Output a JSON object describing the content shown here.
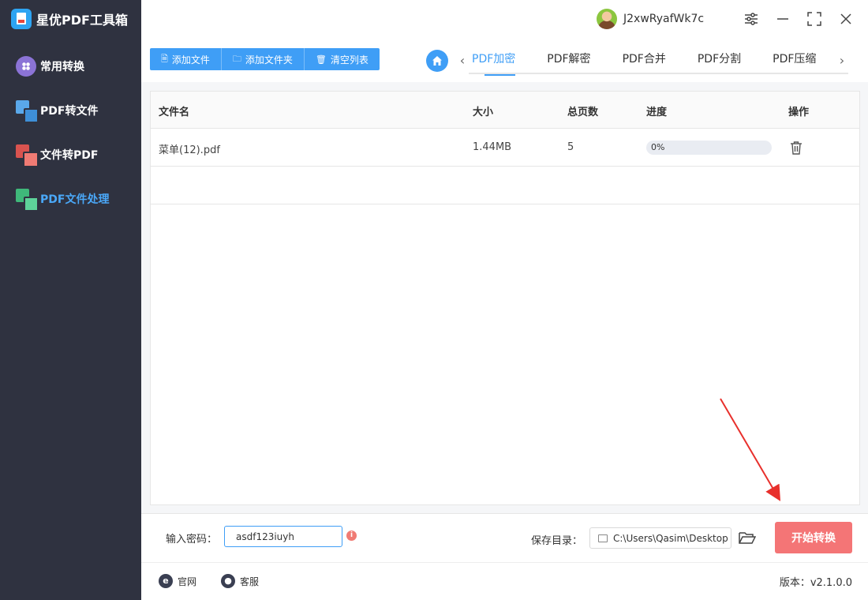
{
  "app": {
    "title": "星优PDF工具箱"
  },
  "sidebar": {
    "items": [
      {
        "label": "常用转换",
        "icon": "grid-icon"
      },
      {
        "label": "PDF转文件",
        "icon": "pdf-to-file-icon"
      },
      {
        "label": "文件转PDF",
        "icon": "file-to-pdf-icon"
      },
      {
        "label": "PDF文件处理",
        "icon": "pdf-process-icon",
        "active": true
      }
    ]
  },
  "header": {
    "username": "J2xwRyafWk7c"
  },
  "toolbar": {
    "add_file": "添加文件",
    "add_folder": "添加文件夹",
    "clear_list": "清空列表"
  },
  "tabs": [
    {
      "label": "PDF加密",
      "active": true
    },
    {
      "label": "PDF解密"
    },
    {
      "label": "PDF合并"
    },
    {
      "label": "PDF分割"
    },
    {
      "label": "PDF压缩"
    }
  ],
  "table": {
    "columns": [
      "文件名",
      "大小",
      "总页数",
      "进度",
      "操作"
    ],
    "rows": [
      {
        "name": "菜单(12).pdf",
        "size": "1.44MB",
        "pages": "5",
        "progress": 0,
        "progress_text": "0%"
      }
    ]
  },
  "settings": {
    "password_label": "输入密码：",
    "password_value": "asdf123iuyh",
    "save_dir_label": "保存目录：",
    "save_dir_value": "C:\\Users\\Qasim\\Desktop",
    "start_button": "开始转换"
  },
  "footer": {
    "website": "官网",
    "support": "客服",
    "version": "版本：v2.1.0.0"
  },
  "colors": {
    "accent": "#3f9ef6",
    "sidebar_bg": "#2f3240",
    "start_button": "#f47576",
    "annotation_arrow": "#e8302c"
  }
}
